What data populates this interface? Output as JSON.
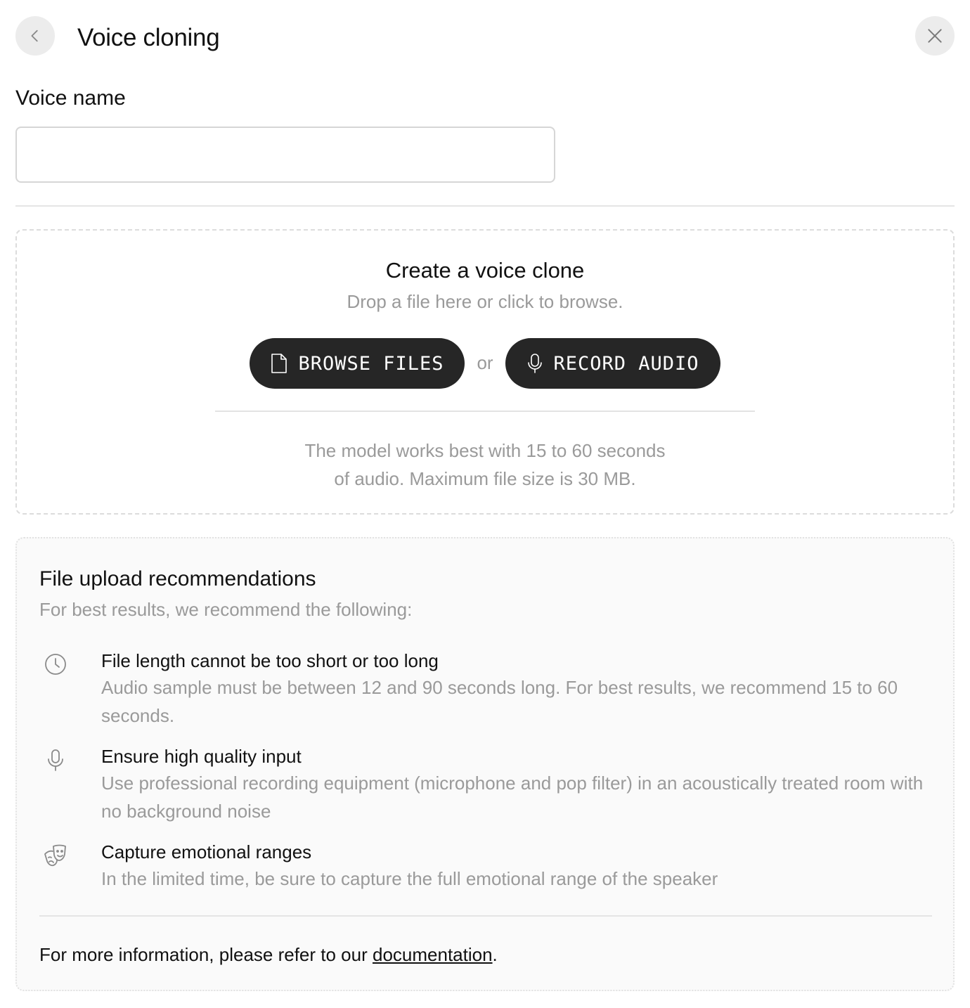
{
  "header": {
    "title": "Voice cloning",
    "back_icon": "chevron-left-icon",
    "close_icon": "close-icon"
  },
  "voice_name": {
    "label": "Voice name",
    "value": "",
    "placeholder": ""
  },
  "dropzone": {
    "title": "Create a voice clone",
    "subtitle": "Drop a file here or click to browse.",
    "browse_label": "BROWSE FILES",
    "browse_icon": "file-icon",
    "or_text": "or",
    "record_label": "RECORD AUDIO",
    "record_icon": "microphone-icon",
    "note_line1": "The model works best with 15 to 60 seconds",
    "note_line2": "of audio. Maximum file size is 30 MB."
  },
  "recommendations": {
    "title": "File upload recommendations",
    "subtitle": "For best results, we recommend the following:",
    "items": [
      {
        "icon": "clock-icon",
        "heading": "File length cannot be too short or too long",
        "body": "Audio sample must be between 12 and 90 seconds long. For best results, we recommend 15 to 60 seconds."
      },
      {
        "icon": "microphone-icon",
        "heading": "Ensure high quality input",
        "body": "Use professional recording equipment (microphone and pop filter) in an acoustically treated room with no background noise"
      },
      {
        "icon": "theater-masks-icon",
        "heading": "Capture emotional ranges",
        "body": "In the limited time, be sure to capture the full emotional range of the speaker"
      }
    ],
    "footer_prefix": "For more information, please refer to our ",
    "footer_link": "documentation",
    "footer_suffix": "."
  },
  "colors": {
    "button_dark": "#262626",
    "muted_text": "#9a9a9a",
    "round_button_bg": "#ececec"
  }
}
